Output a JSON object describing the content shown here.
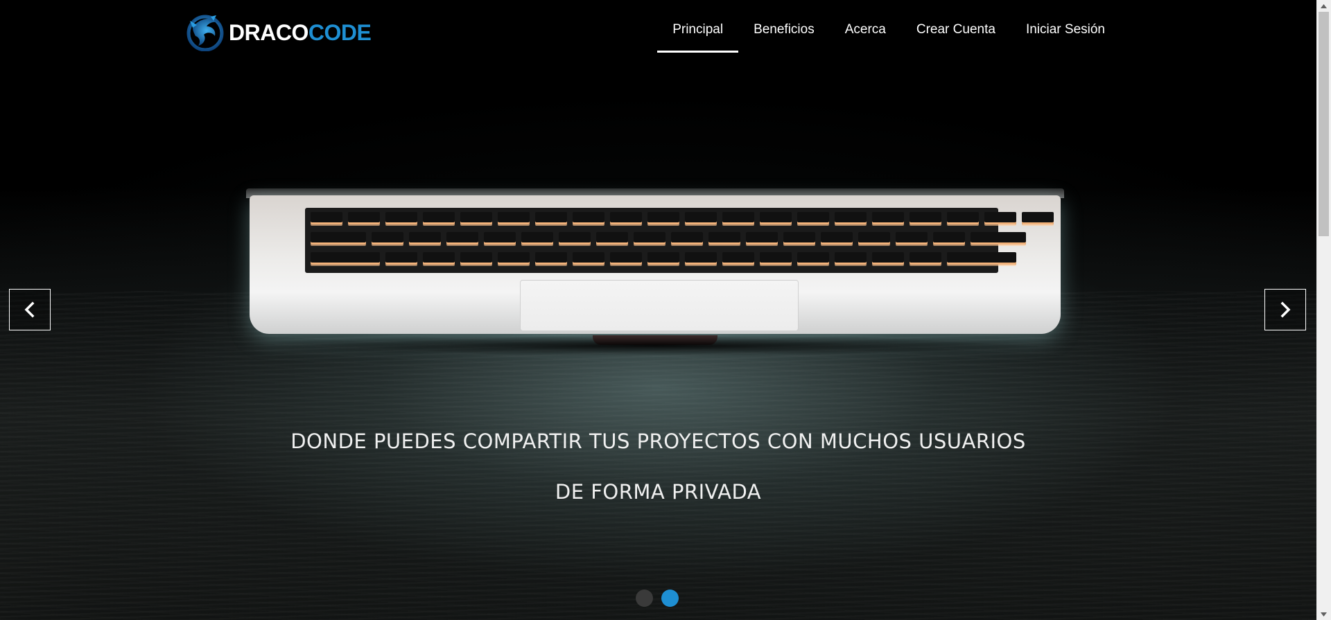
{
  "brand": {
    "part_white": "DRACO",
    "part_blue": "CODE",
    "logo_icon": "dragon-logo",
    "colors": {
      "white": "#ffffff",
      "blue": "#1e8fd3"
    }
  },
  "nav": {
    "items": [
      {
        "label": "Principal",
        "active": true
      },
      {
        "label": "Beneficios",
        "active": false
      },
      {
        "label": "Acerca",
        "active": false
      },
      {
        "label": "Crear Cuenta",
        "active": false
      },
      {
        "label": "Iniciar Sesión",
        "active": false
      }
    ]
  },
  "carousel": {
    "caption_line1": "DONDE PUEDES COMPARTIR TUS PROYECTOS CON MUCHOS USUARIOS",
    "caption_line2": "DE FORMA PRIVADA",
    "prev_icon": "chevron-left-icon",
    "next_icon": "chevron-right-icon",
    "slide_count": 2,
    "active_index": 1,
    "indicator_colors": {
      "inactive": "#3a3a3a",
      "active": "#1e8fd3"
    }
  },
  "scrollbar": {
    "up_icon": "scroll-up-arrow-icon",
    "down_icon": "scroll-down-arrow-icon"
  }
}
